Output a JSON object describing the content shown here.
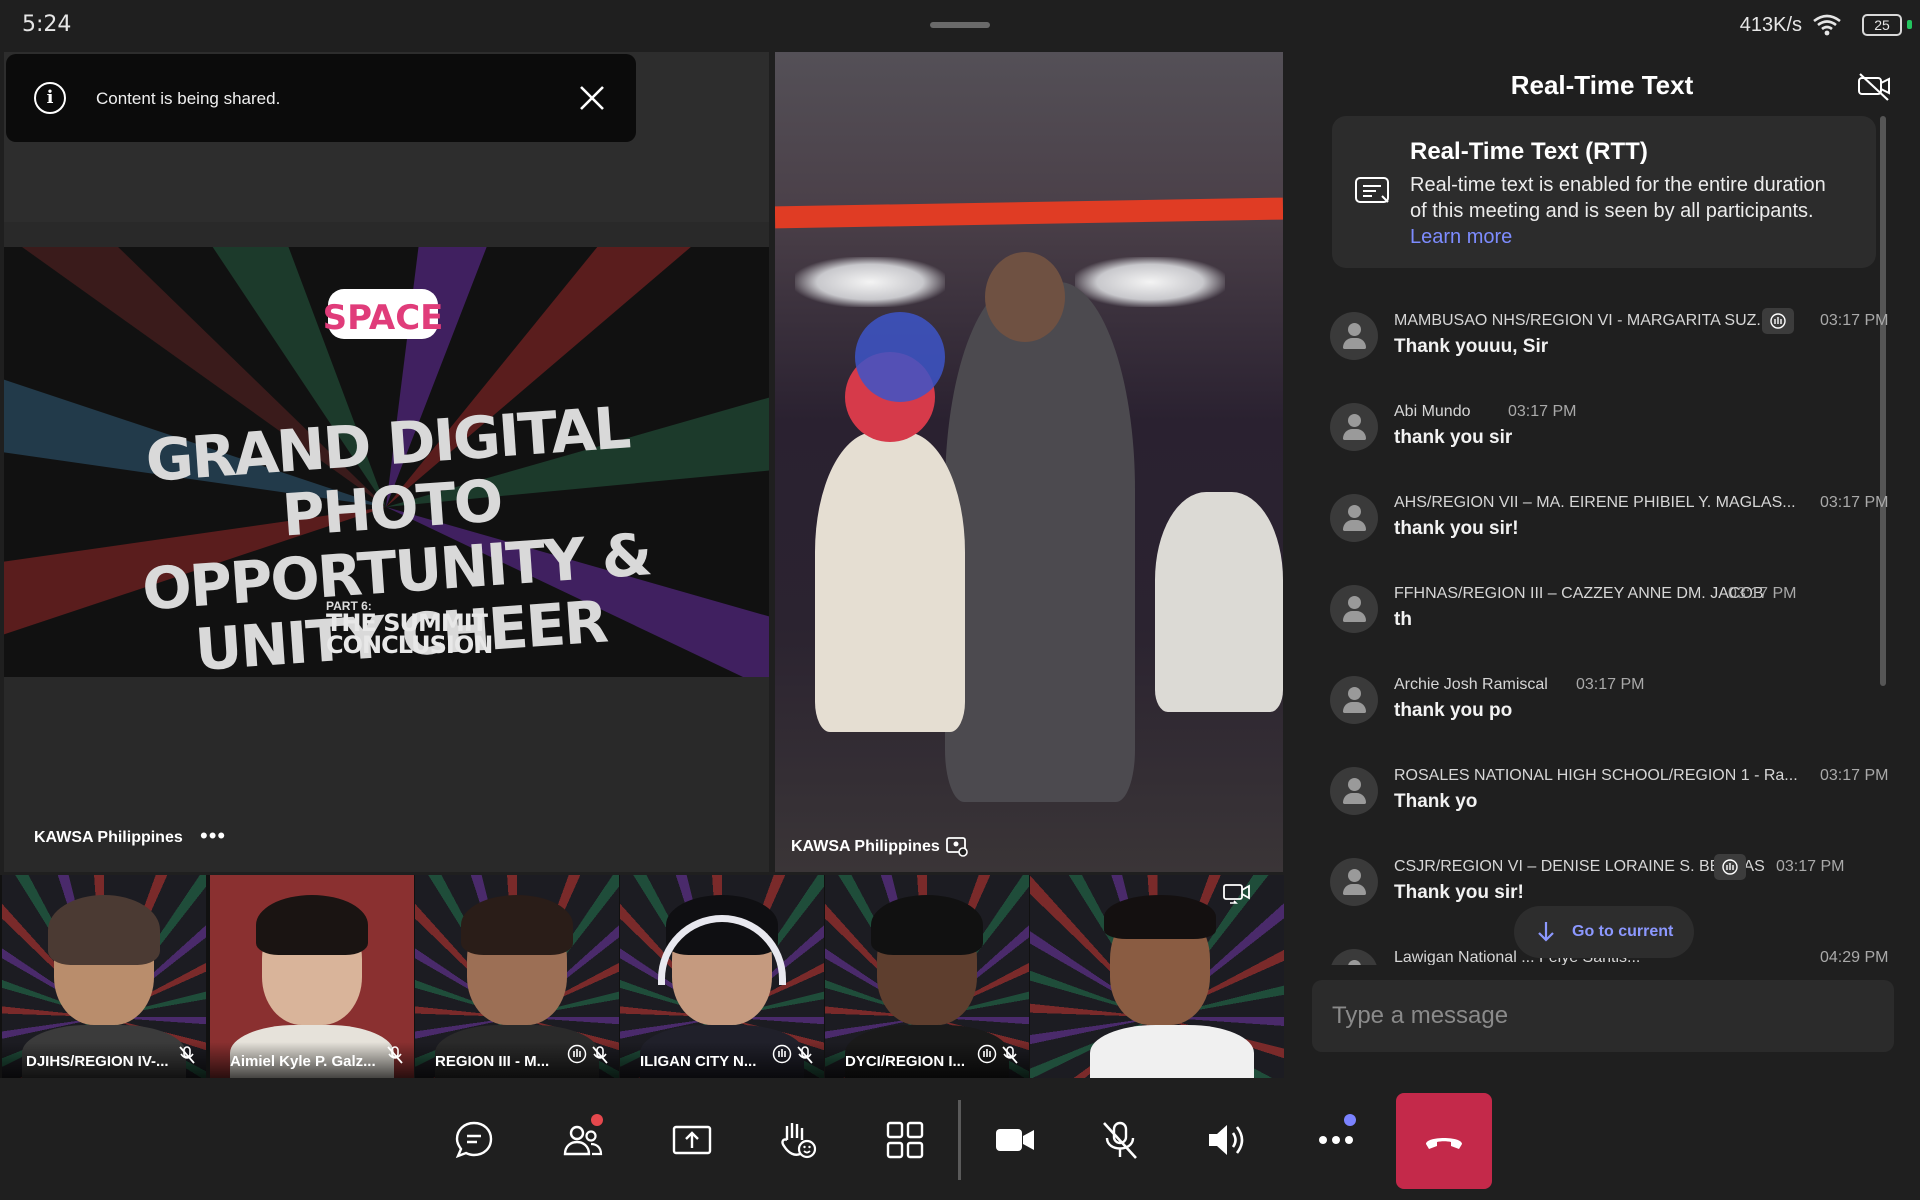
{
  "status": {
    "time": "5:24",
    "net_speed": "413K/s",
    "battery": "25"
  },
  "toast": {
    "text": "Content is being shared."
  },
  "shared": {
    "slide_title_line1": "GRAND DIGITAL PHOTO",
    "slide_title_line2": "OPPORTUNITY & UNITY CHEER",
    "slide_part": "PART 6:",
    "slide_sub_line1": "THE SUMMIT",
    "slide_sub_line2": "CONCLUSION",
    "slide_logo": "SPACE",
    "presenter_name": "KAWSA Philippines",
    "more_label": "•••"
  },
  "video": {
    "name": "KAWSA Philippines"
  },
  "participants": [
    {
      "name": "DJIHS/REGION IV-...",
      "hand": false
    },
    {
      "name": "Aimiel Kyle P. Galz...",
      "hand": false
    },
    {
      "name": "REGION III - M...",
      "hand": true
    },
    {
      "name": "ILIGAN CITY N...",
      "hand": true
    },
    {
      "name": "DYCI/REGION I...",
      "hand": true
    },
    {
      "name": "",
      "hand": false
    }
  ],
  "rtt": {
    "title": "Real-Time Text",
    "card_title": "Real-Time Text (RTT)",
    "card_body": "Real-time text is enabled for the entire duration of this meeting and is seen by all participants.",
    "learn_more": "Learn more",
    "messages": [
      {
        "sender": "MAMBUSAO NHS/REGION VI - MARGARITA SUZ...",
        "time": "03:17 PM",
        "text": "Thank youuu, Sir",
        "tag": true
      },
      {
        "sender": "Abi Mundo",
        "time": "03:17 PM",
        "text": "thank you sir",
        "tag": false
      },
      {
        "sender": "AHS/REGION VII – MA. EIRENE PHIBIEL Y. MAGLAS...",
        "time": "03:17 PM",
        "text": "thank you sir!",
        "tag": false
      },
      {
        "sender": "FFHNAS/REGION III – CAZZEY ANNE DM. JACOB",
        "time": "03:17 PM",
        "text": "th",
        "tag": false
      },
      {
        "sender": "Archie Josh Ramiscal",
        "time": "03:17 PM",
        "text": "thank you po",
        "tag": false
      },
      {
        "sender": "ROSALES NATIONAL HIGH SCHOOL/REGION 1 - Ra...",
        "time": "03:17 PM",
        "text": "Thank yo",
        "tag": false
      },
      {
        "sender": "CSJR/REGION VI – DENISE LORAINE S. BERNAS",
        "time": "03:17 PM",
        "text": "Thank you sir!",
        "tag": true
      },
      {
        "sender": "Lawigan National ... Feiye Santis...",
        "time": "04:29 PM",
        "text": "",
        "tag": false
      }
    ],
    "go_to_current": "Go to current",
    "input_placeholder": "Type a message"
  },
  "colors": {
    "accent": "#7d8cff",
    "hangup": "#c4294a",
    "notification_red": "#e5484d",
    "notification_blue": "#7b83ff"
  },
  "icons": [
    "chat-icon",
    "people-icon",
    "share-screen-icon",
    "raise-hand-icon",
    "layout-icon",
    "camera-icon",
    "mic-off-icon",
    "speaker-icon",
    "more-icon",
    "hang-up-icon"
  ]
}
